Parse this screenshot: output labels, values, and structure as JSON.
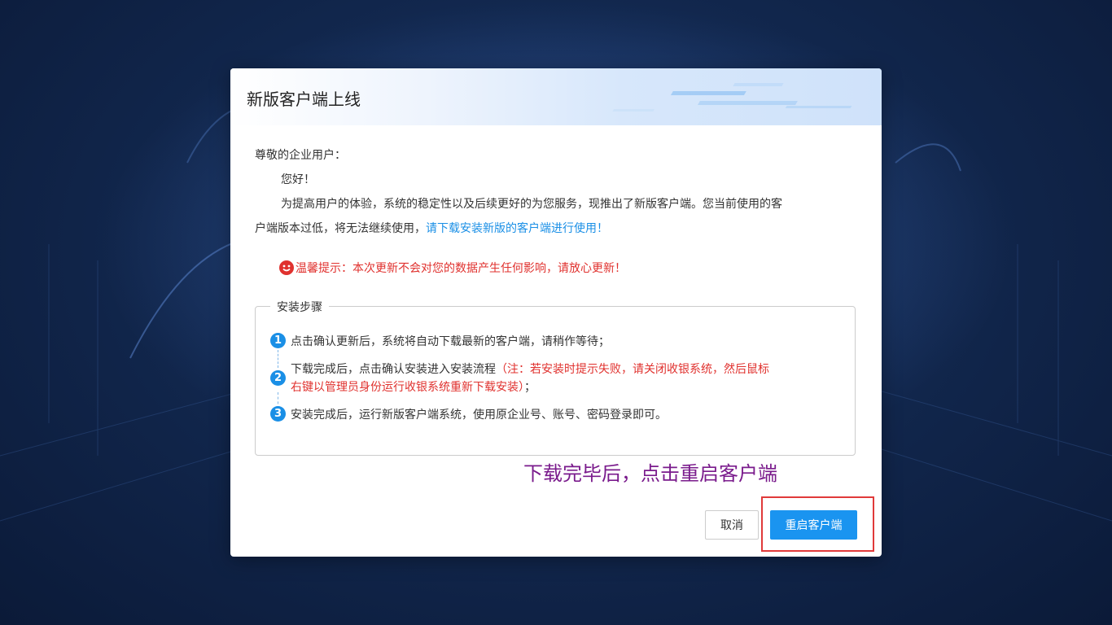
{
  "dialog": {
    "title": "新版客户端上线",
    "greeting": "尊敬的企业用户：",
    "hello": "您好！",
    "paragraph_line1": "为提高用户的体验，系统的稳定性以及后续更好的为您服务，现推出了新版客户端。您当前使用的客",
    "paragraph_line2_plain": "户端版本过低，将无法继续使用，",
    "paragraph_line2_link": "请下载安装新版的客户端进行使用！",
    "tip": "温馨提示：本次更新不会对您的数据产生任何影响，请放心更新！",
    "steps_legend": "安装步骤",
    "steps": [
      {
        "num": "1",
        "text": "点击确认更新后，系统将自动下载最新的客户端，请稍作等待；"
      },
      {
        "num": "2",
        "text_plain": "下载完成后，点击确认安装进入安装流程",
        "text_red_line1": "（注：若安装时提示失败，请关闭收银系统，然后鼠标",
        "text_red_line2": "右键以管理员身份运行收银系统重新下载安装）",
        "text_tail": "；"
      },
      {
        "num": "3",
        "text": "安装完成后，运行新版客户端系统，使用原企业号、账号、密码登录即可。"
      }
    ],
    "cancel_label": "取消",
    "restart_label": "重启客户端"
  },
  "annotation": {
    "text": "下载完毕后，点击重启客户端",
    "color": "#7a1b8c",
    "highlight_color": "#e03a3a"
  },
  "colors": {
    "primary": "#1a94f0",
    "link": "#1a8fe6",
    "warning": "#e0312e"
  }
}
